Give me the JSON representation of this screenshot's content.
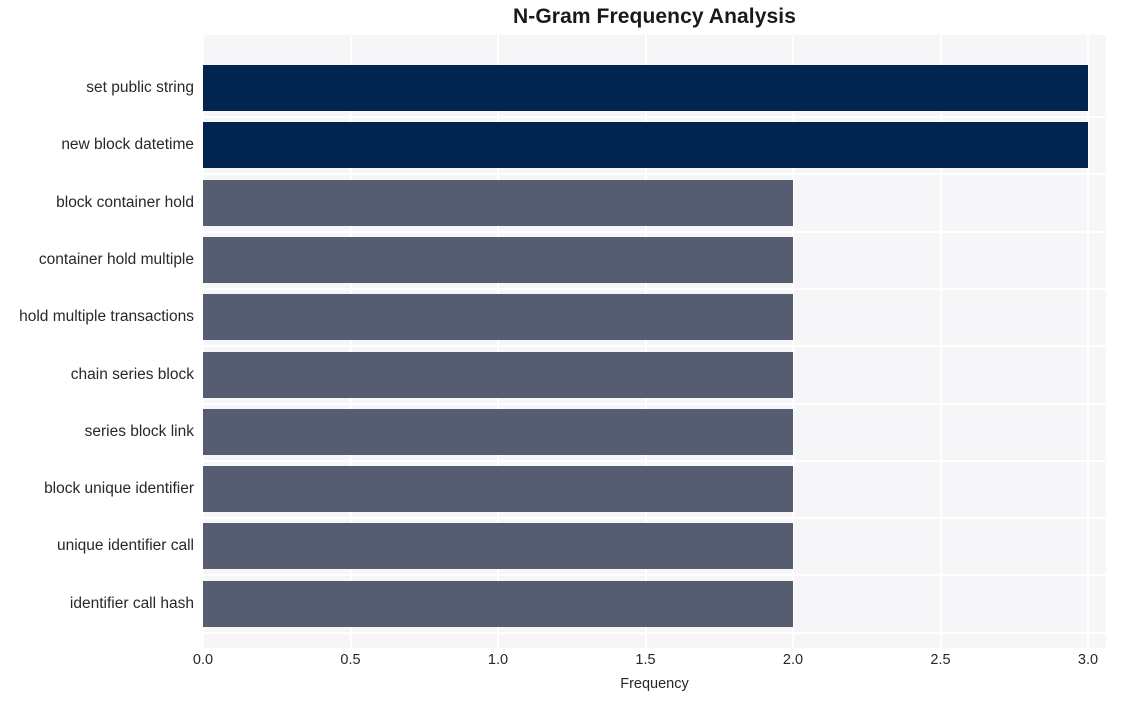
{
  "chart_data": {
    "type": "bar",
    "orientation": "horizontal",
    "title": "N-Gram Frequency Analysis",
    "xlabel": "Frequency",
    "ylabel": "",
    "categories": [
      "set public string",
      "new block datetime",
      "block container hold",
      "container hold multiple",
      "hold multiple transactions",
      "chain series block",
      "series block link",
      "block unique identifier",
      "unique identifier call",
      "identifier call hash"
    ],
    "values": [
      3,
      3,
      2,
      2,
      2,
      2,
      2,
      2,
      2,
      2
    ],
    "xlim": [
      0.0,
      3.0
    ],
    "xticks": [
      "0.0",
      "0.5",
      "1.0",
      "1.5",
      "2.0",
      "2.5",
      "3.0"
    ],
    "xtick_values": [
      0.0,
      0.5,
      1.0,
      1.5,
      2.0,
      2.5,
      3.0
    ],
    "grid": true,
    "legend": false,
    "bar_colors": [
      "#01254e",
      "#01254e",
      "#565d70",
      "#565d70",
      "#565d70",
      "#565d70",
      "#565d70",
      "#565d70",
      "#565d70",
      "#565d70"
    ],
    "colors": {
      "high": "#01254e",
      "low": "#565d70",
      "plot_background": "#f6f6f8",
      "figure_background": "#ffffff",
      "gridline": "#ffffff",
      "text": "#282828"
    }
  }
}
